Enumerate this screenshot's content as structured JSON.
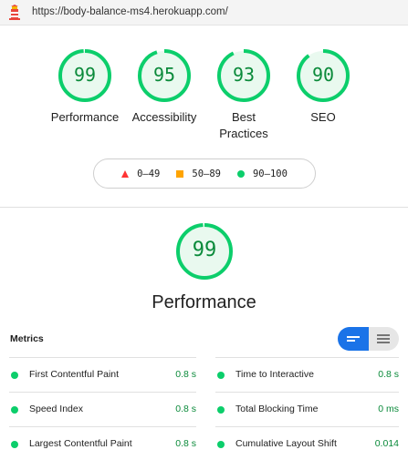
{
  "browser": {
    "url": "https://body-balance-ms4.herokuapp.com/"
  },
  "colors": {
    "pass": "#0cce6b",
    "pass_text": "#0a8a3a",
    "average": "#ffa400",
    "fail": "#ff3333",
    "toggle_active": "#1a73e8"
  },
  "gauges": [
    {
      "score": "99",
      "score_value": 99,
      "label": "Performance"
    },
    {
      "score": "95",
      "score_value": 95,
      "label": "Accessibility"
    },
    {
      "score": "93",
      "score_value": 93,
      "label": "Best Practices"
    },
    {
      "score": "90",
      "score_value": 90,
      "label": "SEO"
    }
  ],
  "legend": [
    {
      "range": "0–49",
      "icon": "triangle-icon"
    },
    {
      "range": "50–89",
      "icon": "square-icon"
    },
    {
      "range": "90–100",
      "icon": "circle-icon"
    }
  ],
  "performance": {
    "score": "99",
    "score_value": 99,
    "title": "Performance"
  },
  "metrics": {
    "title": "Metrics",
    "toggle_options": [
      "compact-view-icon",
      "expanded-view-icon"
    ],
    "items": [
      {
        "name": "First Contentful Paint",
        "value": "0.8 s"
      },
      {
        "name": "Time to Interactive",
        "value": "0.8 s"
      },
      {
        "name": "Speed Index",
        "value": "0.8 s"
      },
      {
        "name": "Total Blocking Time",
        "value": "0 ms"
      },
      {
        "name": "Largest Contentful Paint",
        "value": "0.8 s"
      },
      {
        "name": "Cumulative Layout Shift",
        "value": "0.014"
      }
    ]
  }
}
